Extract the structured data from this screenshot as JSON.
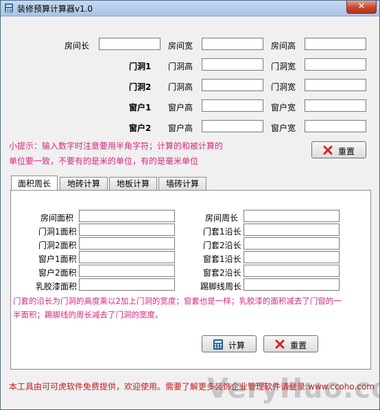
{
  "window": {
    "title": "装修预算计算器v1.0",
    "close_label": "✕"
  },
  "top_form": {
    "room_length_label": "房间长",
    "room_width_label": "房间宽",
    "room_height_label": "房间高",
    "door1_label": "门洞1",
    "door2_label": "门洞2",
    "window1_label": "窗户1",
    "window2_label": "窗户2",
    "door_height_label": "门洞高",
    "door_width_label": "门洞宽",
    "window_height_label": "窗户高",
    "window_width_label": "窗户宽"
  },
  "hint": {
    "line1": "小提示：输入数字时注意要用半角字符；计算的和被计算的",
    "line2": "单位要一致，不要有的是米的单位，有的是毫米单位"
  },
  "buttons": {
    "reset_label": "重置",
    "calc_label": "计算"
  },
  "tabs": [
    {
      "label": "面积周长"
    },
    {
      "label": "地砖计算"
    },
    {
      "label": "地板计算"
    },
    {
      "label": "墙砖计算"
    }
  ],
  "area_panel": {
    "room_area_label": "房间面积",
    "door1_area_label": "门洞1面积",
    "door2_area_label": "门洞2面积",
    "window1_area_label": "窗户1面积",
    "window2_area_label": "窗户2面积",
    "paint_area_label": "乳胶漆面积",
    "room_perimeter_label": "房间周长",
    "door_set1_label": "门套1沿长",
    "door_set2_label": "门套2沿长",
    "window_set1_label": "窗套1沿长",
    "window_set2_label": "窗套2沿长",
    "skirting_label": "踢脚线周长",
    "note_line1": "门套的沿长为门洞的高度乘以2加上门洞的宽度；窗套也是一样；乳胶漆的面积减去了门窗的一",
    "note_line2": "半面积；踢脚线的周长减去了门洞的宽度。"
  },
  "footer": {
    "text": "本工具由可可虎软件免费提供，欢迎使用。需要了解更多装饰企业管理软件请登录:www.ccoho.com"
  },
  "watermark": {
    "text": "VeryHuo.com"
  },
  "icons": {
    "reset": "red-x-icon",
    "calc": "calculator-icon"
  },
  "colors": {
    "hint": "#d8277f",
    "footer": "#c21a1a",
    "reset_x": "#d62020"
  }
}
